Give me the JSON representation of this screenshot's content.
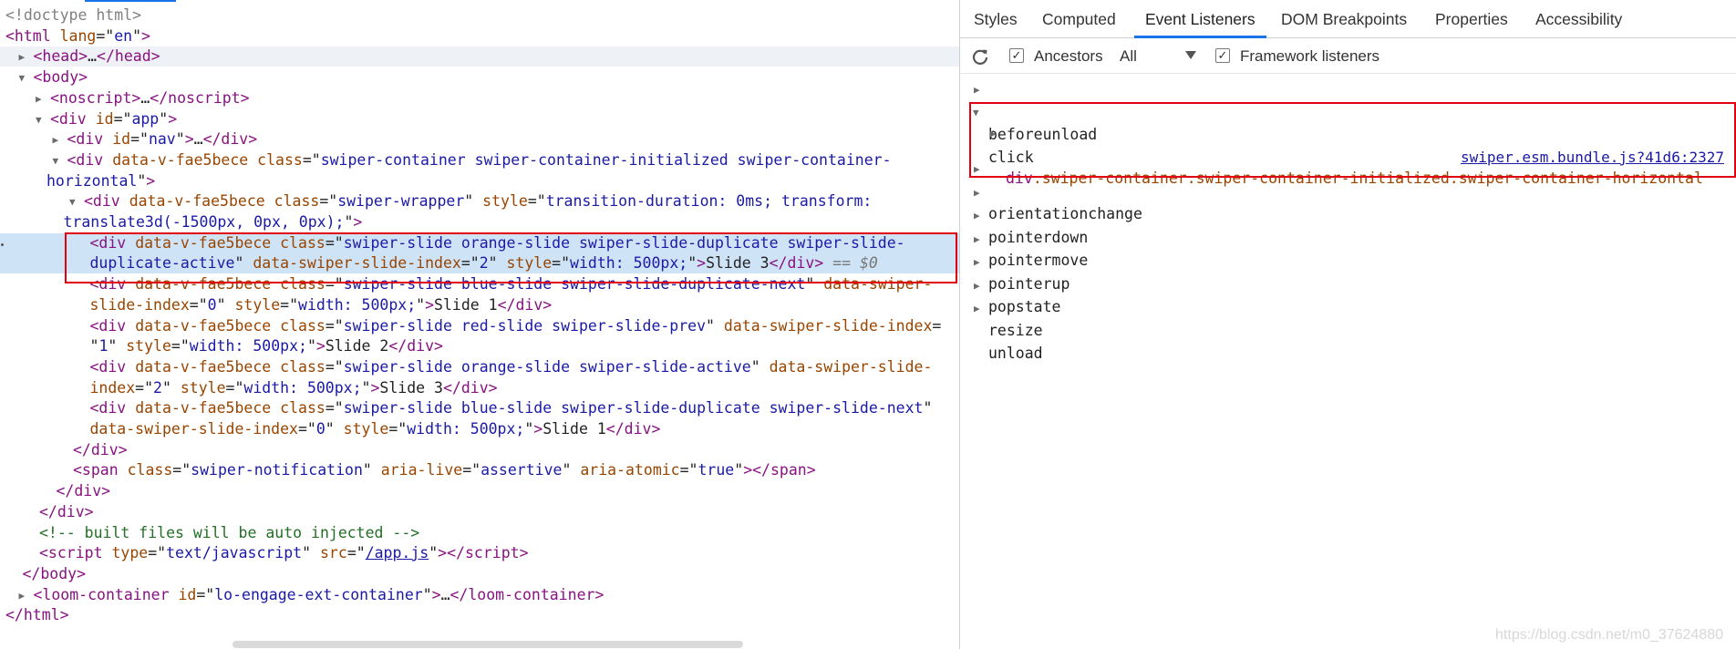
{
  "elements_panel": {
    "lines": [
      {
        "indent": 0,
        "tri": "",
        "html": "<span class='dt'>&lt;!doctype html&gt;</span>"
      },
      {
        "indent": 0,
        "tri": "",
        "html": "<span class='tg'>&lt;html</span> <span class='at'>lang</span>=\"<span class='av'>en</span>\"<span class='tg'>&gt;</span>"
      },
      {
        "indent": 1,
        "tri": "right",
        "row": "head-row",
        "html": "<span class='tg'>&lt;head&gt;</span>…<span class='tg'>&lt;/head&gt;</span>"
      },
      {
        "indent": 1,
        "tri": "down",
        "html": "<span class='tg'>&lt;body&gt;</span>"
      },
      {
        "indent": 2,
        "tri": "right",
        "html": "<span class='tg'>&lt;noscript&gt;</span>…<span class='tg'>&lt;/noscript&gt;</span>"
      },
      {
        "indent": 2,
        "tri": "down",
        "html": "<span class='tg'>&lt;div</span> <span class='at'>id</span>=\"<span class='av'>app</span>\"<span class='tg'>&gt;</span>"
      },
      {
        "indent": 3,
        "tri": "right",
        "html": "<span class='tg'>&lt;div</span> <span class='at'>id</span>=\"<span class='av'>nav</span>\"<span class='tg'>&gt;</span>…<span class='tg'>&lt;/div&gt;</span>"
      },
      {
        "indent": 3,
        "tri": "down",
        "html": "<span class='tg'>&lt;div</span> <span class='at'>data-v-fae5bece</span> <span class='at'>class</span>=\"<span class='av'>swiper-container swiper-container-initialized swiper-container-</span>"
      },
      {
        "indent": 2,
        "tri": "",
        "cont": true,
        "html": "<span class='av'>horizontal</span>\"<span class='tg'>&gt;</span>"
      },
      {
        "indent": 4,
        "tri": "down",
        "html": "<span class='tg'>&lt;div</span> <span class='at'>data-v-fae5bece</span> <span class='at'>class</span>=\"<span class='av'>swiper-wrapper</span>\" <span class='at'>style</span>=\"<span class='av'>transition-duration: 0ms; transform:</span>"
      },
      {
        "indent": 3,
        "tri": "",
        "cont": true,
        "html": "<span class='av'>translate3d(-1500px, 0px, 0px);</span>\"<span class='tg'>&gt;</span>"
      },
      {
        "indent": 5,
        "tri": "",
        "row": "hl",
        "dot": true,
        "html": "<span class='tg'>&lt;div</span> <span class='at'>data-v-fae5bece</span> <span class='at'>class</span>=\"<span class='av'>swiper-slide orange-slide swiper-slide-duplicate swiper-slide-</span>"
      },
      {
        "indent": 5,
        "tri": "",
        "row": "hl",
        "html": "<span class='av'>duplicate-active</span>\" <span class='at'>data-swiper-slide-index</span>=\"<span class='av'>2</span>\" <span class='at'>style</span>=\"<span class='av'>width: 500px;</span>\"<span class='tg'>&gt;</span>Slide 3<span class='tg'>&lt;/div&gt;</span> <span class='eq'>== $0</span>"
      },
      {
        "indent": 5,
        "tri": "",
        "html": "<span class='tg'>&lt;div</span> <span class='at'>data-v-fae5bece</span> <span class='at'>class</span>=\"<span class='av'>swiper-slide blue-slide swiper-slide-duplicate-next</span>\" <span class='at'>data-swiper-</span>"
      },
      {
        "indent": 5,
        "tri": "",
        "html": "<span class='at'>slide-index</span>=\"<span class='av'>0</span>\" <span class='at'>style</span>=\"<span class='av'>width: 500px;</span>\"<span class='tg'>&gt;</span>Slide 1<span class='tg'>&lt;/div&gt;</span>"
      },
      {
        "indent": 5,
        "tri": "",
        "html": "<span class='tg'>&lt;div</span> <span class='at'>data-v-fae5bece</span> <span class='at'>class</span>=\"<span class='av'>swiper-slide red-slide swiper-slide-prev</span>\" <span class='at'>data-swiper-slide-index</span>="
      },
      {
        "indent": 5,
        "tri": "",
        "html": "\"<span class='av'>1</span>\" <span class='at'>style</span>=\"<span class='av'>width: 500px;</span>\"<span class='tg'>&gt;</span>Slide 2<span class='tg'>&lt;/div&gt;</span>"
      },
      {
        "indent": 5,
        "tri": "",
        "html": "<span class='tg'>&lt;div</span> <span class='at'>data-v-fae5bece</span> <span class='at'>class</span>=\"<span class='av'>swiper-slide orange-slide swiper-slide-active</span>\" <span class='at'>data-swiper-slide-</span>"
      },
      {
        "indent": 5,
        "tri": "",
        "html": "<span class='at'>index</span>=\"<span class='av'>2</span>\" <span class='at'>style</span>=\"<span class='av'>width: 500px;</span>\"<span class='tg'>&gt;</span>Slide 3<span class='tg'>&lt;/div&gt;</span>"
      },
      {
        "indent": 5,
        "tri": "",
        "html": "<span class='tg'>&lt;div</span> <span class='at'>data-v-fae5bece</span> <span class='at'>class</span>=\"<span class='av'>swiper-slide blue-slide swiper-slide-duplicate swiper-slide-next</span>\""
      },
      {
        "indent": 5,
        "tri": "",
        "html": "<span class='at'>data-swiper-slide-index</span>=\"<span class='av'>0</span>\" <span class='at'>style</span>=\"<span class='av'>width: 500px;</span>\"<span class='tg'>&gt;</span>Slide 1<span class='tg'>&lt;/div&gt;</span>"
      },
      {
        "indent": 4,
        "tri": "",
        "html": "<span class='tg'>&lt;/div&gt;</span>"
      },
      {
        "indent": 4,
        "tri": "",
        "html": "<span class='tg'>&lt;span</span> <span class='at'>class</span>=\"<span class='av'>swiper-notification</span>\" <span class='at'>aria-live</span>=\"<span class='av'>assertive</span>\" <span class='at'>aria-atomic</span>=\"<span class='av'>true</span>\"<span class='tg'>&gt;&lt;/span&gt;</span>"
      },
      {
        "indent": 3,
        "tri": "",
        "html": "<span class='tg'>&lt;/div&gt;</span>"
      },
      {
        "indent": 2,
        "tri": "",
        "html": "<span class='tg'>&lt;/div&gt;</span>"
      },
      {
        "indent": 2,
        "tri": "",
        "html": "<span class='cm'>&lt;!-- built files will be auto injected --&gt;</span>"
      },
      {
        "indent": 2,
        "tri": "",
        "html": "<span class='tg'>&lt;script</span> <span class='at'>type</span>=\"<span class='av'>text/javascript</span>\" <span class='at'>src</span>=\"<span class='lk'>/app.js</span>\"<span class='tg'>&gt;&lt;/script&gt;</span>"
      },
      {
        "indent": 1,
        "tri": "",
        "html": "<span class='tg'>&lt;/body&gt;</span>"
      },
      {
        "indent": 1,
        "tri": "right",
        "html": "<span class='tg'>&lt;loom-container</span> <span class='at'>id</span>=\"<span class='av'>lo-engage-ext-container</span>\"<span class='tg'>&gt;</span>…<span class='tg'>&lt;/loom-container&gt;</span>"
      },
      {
        "indent": 0,
        "tri": "",
        "html": "<span class='tg'>&lt;/html&gt;</span>"
      }
    ]
  },
  "sidebar": {
    "tabs": [
      "Styles",
      "Computed",
      "Event Listeners",
      "DOM Breakpoints",
      "Properties",
      "Accessibility"
    ],
    "active_tab": "Event Listeners",
    "toolbar": {
      "ancestors_label": "Ancestors",
      "ancestors_checked": true,
      "filter_value": "All",
      "framework_label": "Framework listeners",
      "framework_checked": true
    },
    "events": [
      "beforeunload",
      "click",
      "orientationchange",
      "pointerdown",
      "pointermove",
      "pointerup",
      "popstate",
      "resize",
      "unload"
    ],
    "expanded_event": "click",
    "listener": {
      "node_tag": "div",
      "node_classes": ".swiper-container.swiper-container-initialized.swiper-container-horizontal",
      "source": "swiper.esm.bundle.js?41d6:2327"
    }
  },
  "watermark": "https://blog.csdn.net/m0_37624880",
  "colors": {
    "accent": "#1a73e8",
    "annotation_red": "#e0000f",
    "selected_row": "#cfe3f7"
  }
}
